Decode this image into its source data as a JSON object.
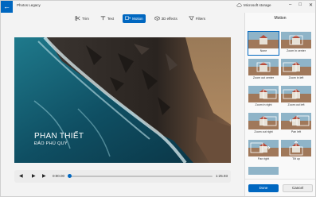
{
  "window": {
    "app_title": "Photos Legacy",
    "storage_label": "Microsoft storage",
    "back_icon": "back-arrow-icon",
    "controls": [
      "minimize-icon",
      "maximize-icon",
      "close-icon"
    ]
  },
  "toolbar": {
    "items": [
      {
        "label": "Trim",
        "icon": "trim-icon",
        "active": false
      },
      {
        "label": "Text",
        "icon": "text-icon",
        "active": false
      },
      {
        "label": "Motion",
        "icon": "motion-icon",
        "active": true
      },
      {
        "label": "3D effects",
        "icon": "3d-effects-icon",
        "active": false
      },
      {
        "label": "Filters",
        "icon": "filters-icon",
        "active": false
      }
    ]
  },
  "video": {
    "caption_title": "PHAN THIẾT",
    "caption_subtitle": "ĐẢO PHÚ QUÝ"
  },
  "playback": {
    "current_time": "0:00.00",
    "end_time": "1:25.93",
    "progress_fraction": 0.0
  },
  "panel": {
    "title": "Motion",
    "options": [
      {
        "label": "None",
        "selected": true
      },
      {
        "label": "Zoom in center",
        "selected": false
      },
      {
        "label": "Zoom out center",
        "selected": false
      },
      {
        "label": "Zoom in left",
        "selected": false
      },
      {
        "label": "Zoom in right",
        "selected": false
      },
      {
        "label": "Zoom out left",
        "selected": false
      },
      {
        "label": "Zoom out right",
        "selected": false
      },
      {
        "label": "Pan left",
        "selected": false
      },
      {
        "label": "Pan right",
        "selected": false
      },
      {
        "label": "Tilt up",
        "selected": false
      }
    ],
    "done_label": "Done",
    "cancel_label": "Cancel"
  },
  "colors": {
    "accent": "#0067c0",
    "sea": "#0e5a6e",
    "rock": "#2a2420"
  }
}
